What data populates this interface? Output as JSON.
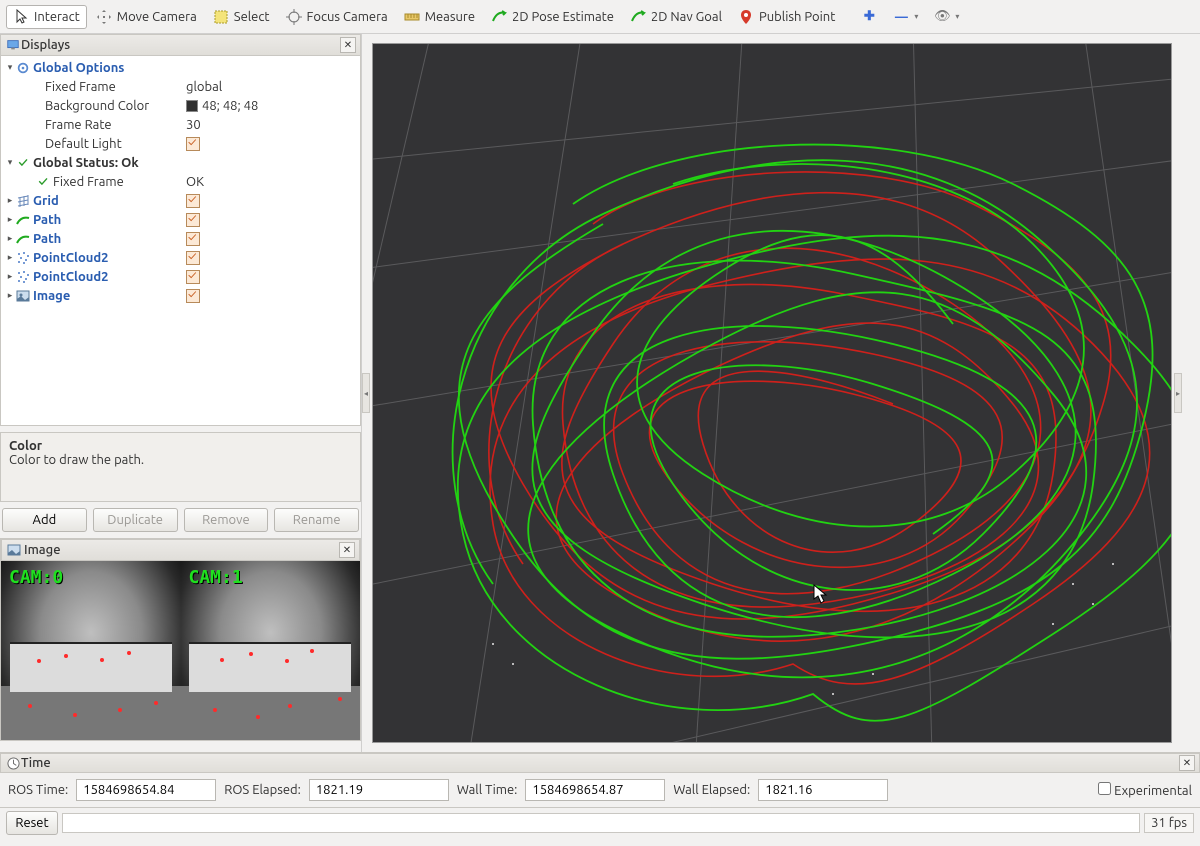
{
  "toolbar": {
    "interact": "Interact",
    "move_camera": "Move Camera",
    "select": "Select",
    "focus_camera": "Focus Camera",
    "measure": "Measure",
    "pose_estimate": "2D Pose Estimate",
    "nav_goal": "2D Nav Goal",
    "publish_point": "Publish Point"
  },
  "panels": {
    "displays_title": "Displays",
    "image_title": "Image",
    "time_title": "Time"
  },
  "tree": {
    "global_options": "Global Options",
    "fixed_frame_label": "Fixed Frame",
    "fixed_frame_value": "global",
    "bg_color_label": "Background Color",
    "bg_color_value": "48; 48; 48",
    "frame_rate_label": "Frame Rate",
    "frame_rate_value": "30",
    "default_light_label": "Default Light",
    "global_status": "Global Status: Ok",
    "fixed_frame_status_label": "Fixed Frame",
    "fixed_frame_status_value": "OK",
    "grid": "Grid",
    "path1": "Path",
    "path2": "Path",
    "pc1": "PointCloud2",
    "pc2": "PointCloud2",
    "image": "Image"
  },
  "help": {
    "title": "Color",
    "desc": "Color to draw the path."
  },
  "buttons": {
    "add": "Add",
    "duplicate": "Duplicate",
    "remove": "Remove",
    "rename": "Rename",
    "reset": "Reset"
  },
  "camera": {
    "cam0": "CAM:0",
    "cam1": "CAM:1"
  },
  "time": {
    "ros_time_label": "ROS Time:",
    "ros_time_value": "1584698654.84",
    "ros_elapsed_label": "ROS Elapsed:",
    "ros_elapsed_value": "1821.19",
    "wall_time_label": "Wall Time:",
    "wall_time_value": "1584698654.87",
    "wall_elapsed_label": "Wall Elapsed:",
    "wall_elapsed_value": "1821.16",
    "experimental": "Experimental"
  },
  "status": {
    "fps": "31 fps"
  },
  "colors": {
    "path_green": "#22d312",
    "path_red": "#d8201a",
    "grid": "#5a5a5c",
    "viewport_bg": "#333335",
    "accent_orange": "#e06a1e"
  }
}
